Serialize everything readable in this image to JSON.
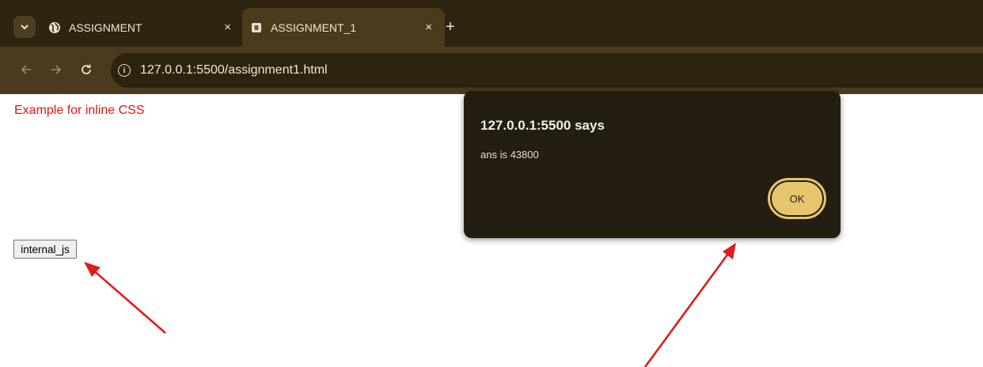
{
  "browser": {
    "tabs": [
      {
        "title": "ASSIGNMENT",
        "icon": "globe-icon",
        "active": false
      },
      {
        "title": "ASSIGNMENT_1",
        "icon": "page-icon",
        "active": true
      }
    ],
    "new_tab_symbol": "+",
    "tab_close_symbol": "×",
    "url": "127.0.0.1:5500/assignment1.html"
  },
  "page": {
    "heading": "Example for inline CSS",
    "button_label": "internal_js"
  },
  "dialog": {
    "title": "127.0.0.1:5500 says",
    "message": "ans is 43800",
    "ok_label": "OK"
  },
  "colors": {
    "heading": "#ee1111",
    "arrow": "#e01b1b",
    "ok_button": "#e6c56f",
    "dialog_bg": "#231d12"
  }
}
